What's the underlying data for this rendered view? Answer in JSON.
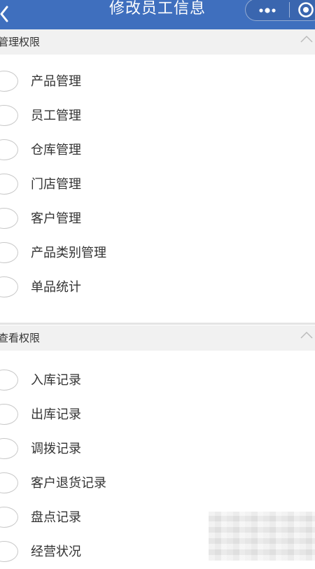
{
  "navbar": {
    "title": "修改员工信息",
    "back_icon": "chevron-left-icon",
    "more_icon": "more-dots-icon",
    "close_icon": "target-close-icon",
    "background": "#3f6fbe"
  },
  "sections": [
    {
      "title": "管理权限",
      "items": [
        "产品管理",
        "员工管理",
        "仓库管理",
        "门店管理",
        "客户管理",
        "产品类别管理",
        "单品统计"
      ]
    },
    {
      "title": "查看权限",
      "items": [
        "入库记录",
        "出库记录",
        "调拨记录",
        "客户退货记录",
        "盘点记录",
        "经营状况"
      ]
    }
  ]
}
